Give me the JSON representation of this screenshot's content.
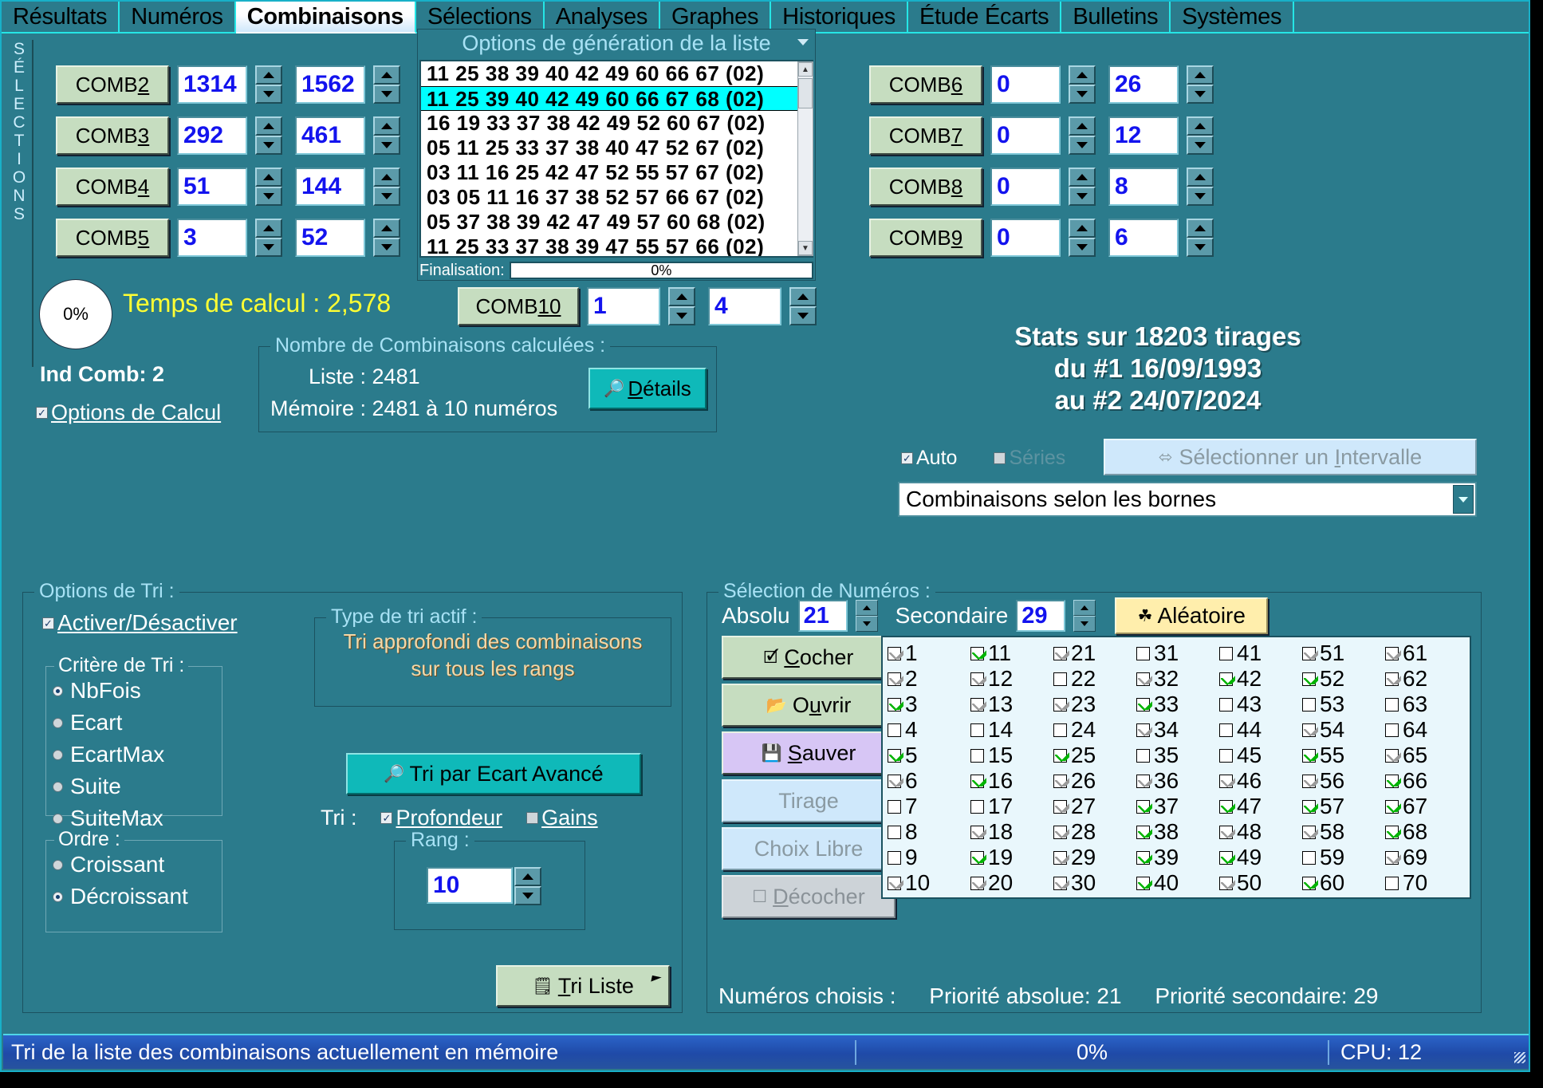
{
  "tabs": [
    {
      "label": "Résultats",
      "active": false
    },
    {
      "label": "Numéros",
      "active": false
    },
    {
      "label": "Combinaisons",
      "active": true
    },
    {
      "label": "Sélections",
      "active": false
    },
    {
      "label": "Analyses",
      "active": false
    },
    {
      "label": "Graphes",
      "active": false
    },
    {
      "label": "Historiques",
      "active": false
    },
    {
      "label": "Étude Écarts",
      "active": false
    },
    {
      "label": "Bulletins",
      "active": false
    },
    {
      "label": "Systèmes",
      "active": false
    }
  ],
  "vertical_strip": "SÉLECTIONS",
  "comb_left": [
    {
      "label_prefix": "COMB ",
      "label_key": "2",
      "min": "1314",
      "max": "1562"
    },
    {
      "label_prefix": "COMB ",
      "label_key": "3",
      "min": "292",
      "max": "461"
    },
    {
      "label_prefix": "COMB ",
      "label_key": "4",
      "min": "51",
      "max": "144"
    },
    {
      "label_prefix": "COMB ",
      "label_key": "5",
      "min": "3",
      "max": "52"
    }
  ],
  "comb_right": [
    {
      "label_prefix": "COMB ",
      "label_key": "6",
      "min": "0",
      "max": "26"
    },
    {
      "label_prefix": "COMB ",
      "label_key": "7",
      "min": "0",
      "max": "12"
    },
    {
      "label_prefix": "COMB ",
      "label_key": "8",
      "min": "0",
      "max": "8"
    },
    {
      "label_prefix": "COMB ",
      "label_key": "9",
      "min": "0",
      "max": "6"
    }
  ],
  "comb10": {
    "label_prefix": "COMB ",
    "label_key": "10",
    "min": "1",
    "max": "4"
  },
  "list_panel": {
    "title": "Options de génération de la liste",
    "rows": [
      {
        "numbers": "11 25 38 39 40 42 49 60 66 67",
        "tag": "(02)",
        "selected": false
      },
      {
        "numbers": "11 25 39 40 42 49 60 66 67 68",
        "tag": "(02)",
        "selected": true
      },
      {
        "numbers": "16 19 33 37 38 42 49 52 60 67",
        "tag": "(02)",
        "selected": false
      },
      {
        "numbers": "05 11 25 33 37 38 40 47 52 67",
        "tag": "(02)",
        "selected": false
      },
      {
        "numbers": "03 11 16 25 42 47 52 55 57 67",
        "tag": "(02)",
        "selected": false
      },
      {
        "numbers": "03 05 11 16 37 38 52 57 66 67",
        "tag": "(02)",
        "selected": false
      },
      {
        "numbers": "05 37 38 39 42 47 49 57 60 68",
        "tag": "(02)",
        "selected": false
      },
      {
        "numbers": "11 25 33 37 38 39 47 55 57 66",
        "tag": "(02)",
        "selected": false
      }
    ],
    "finalisation_label": "Finalisation:",
    "finalisation_value": "0%"
  },
  "progress_pie": "0%",
  "temps_de_calcul": "Temps de calcul : 2,578",
  "ind_comb": "Ind Comb: 2",
  "options_de_calcul": "Options de Calcul",
  "nombre_combinaisons": {
    "title": "Nombre de Combinaisons calculées :",
    "liste": "Liste :  2481",
    "memoire": "Mémoire :  2481 à 10 numéros",
    "details_button": "Détails"
  },
  "stats": {
    "line1": "Stats sur 18203 tirages",
    "line2": "du #1 16/09/1993",
    "line3": "au #2 24/07/2024"
  },
  "auto_label": "Auto",
  "series_label": "Séries",
  "interval_button": "Sélectionner un Intervalle",
  "combo_value": "Combinaisons selon les bornes",
  "options_tri": {
    "title": "Options de Tri :",
    "activer": "Activer/Désactiver",
    "critere_title": "Critère de Tri :",
    "criteres": [
      {
        "label": "NbFois",
        "selected": true
      },
      {
        "label": "Ecart",
        "selected": false
      },
      {
        "label": "EcartMax",
        "selected": false
      },
      {
        "label": "Suite",
        "selected": false
      },
      {
        "label": "SuiteMax",
        "selected": false
      }
    ],
    "ordre_title": "Ordre :",
    "ordres": [
      {
        "label": "Croissant",
        "selected": false
      },
      {
        "label": "Décroissant",
        "selected": true
      }
    ],
    "type_title": "Type de tri actif :",
    "type_text_line1": "Tri approfondi des combinaisons",
    "type_text_line2": "sur tous les rangs",
    "tri_avance_button": "Tri par Ecart Avancé",
    "tri_label": "Tri :",
    "profondeur": "Profondeur",
    "gains": "Gains",
    "rang_title": "Rang :",
    "rang_value": "10",
    "tri_liste_button": "Tri Liste"
  },
  "selection_numeros": {
    "title": "Sélection de Numéros :",
    "buttons": [
      {
        "label": "Cocher",
        "icon": "checklist-icon",
        "style": "green",
        "enabled": true
      },
      {
        "label": "Ouvrir",
        "icon": "folder-open-icon",
        "style": "green",
        "enabled": true
      },
      {
        "label": "Sauver",
        "icon": "floppy-icon",
        "style": "purple",
        "enabled": true
      },
      {
        "label": "Tirage",
        "icon": "none",
        "style": "disabled",
        "enabled": false
      },
      {
        "label": "Choix Libre",
        "icon": "none",
        "style": "disabled",
        "enabled": false
      },
      {
        "label": "Décocher",
        "icon": "uncheck-icon",
        "style": "gray",
        "enabled": false
      }
    ],
    "absolu_label": "Absolu",
    "absolu_value": "21",
    "secondaire_label": "Secondaire",
    "secondaire_value": "29",
    "aleatoire_label": "Aléatoire",
    "numbers": [
      {
        "n": "1",
        "state": "gray"
      },
      {
        "n": "2",
        "state": "gray"
      },
      {
        "n": "3",
        "state": "green"
      },
      {
        "n": "4",
        "state": "off"
      },
      {
        "n": "5",
        "state": "green"
      },
      {
        "n": "6",
        "state": "gray"
      },
      {
        "n": "7",
        "state": "off"
      },
      {
        "n": "8",
        "state": "off"
      },
      {
        "n": "9",
        "state": "off"
      },
      {
        "n": "10",
        "state": "gray"
      },
      {
        "n": "11",
        "state": "green"
      },
      {
        "n": "12",
        "state": "gray"
      },
      {
        "n": "13",
        "state": "gray"
      },
      {
        "n": "14",
        "state": "off"
      },
      {
        "n": "15",
        "state": "off"
      },
      {
        "n": "16",
        "state": "green"
      },
      {
        "n": "17",
        "state": "off"
      },
      {
        "n": "18",
        "state": "gray"
      },
      {
        "n": "19",
        "state": "green"
      },
      {
        "n": "20",
        "state": "gray"
      },
      {
        "n": "21",
        "state": "gray"
      },
      {
        "n": "22",
        "state": "off"
      },
      {
        "n": "23",
        "state": "gray"
      },
      {
        "n": "24",
        "state": "off"
      },
      {
        "n": "25",
        "state": "green"
      },
      {
        "n": "26",
        "state": "gray"
      },
      {
        "n": "27",
        "state": "gray"
      },
      {
        "n": "28",
        "state": "gray"
      },
      {
        "n": "29",
        "state": "gray"
      },
      {
        "n": "30",
        "state": "gray"
      },
      {
        "n": "31",
        "state": "off"
      },
      {
        "n": "32",
        "state": "gray"
      },
      {
        "n": "33",
        "state": "green"
      },
      {
        "n": "34",
        "state": "gray"
      },
      {
        "n": "35",
        "state": "off"
      },
      {
        "n": "36",
        "state": "gray"
      },
      {
        "n": "37",
        "state": "green"
      },
      {
        "n": "38",
        "state": "green"
      },
      {
        "n": "39",
        "state": "green"
      },
      {
        "n": "40",
        "state": "green"
      },
      {
        "n": "41",
        "state": "off"
      },
      {
        "n": "42",
        "state": "green"
      },
      {
        "n": "43",
        "state": "off"
      },
      {
        "n": "44",
        "state": "off"
      },
      {
        "n": "45",
        "state": "off"
      },
      {
        "n": "46",
        "state": "gray"
      },
      {
        "n": "47",
        "state": "green"
      },
      {
        "n": "48",
        "state": "gray"
      },
      {
        "n": "49",
        "state": "green"
      },
      {
        "n": "50",
        "state": "gray"
      },
      {
        "n": "51",
        "state": "gray"
      },
      {
        "n": "52",
        "state": "green"
      },
      {
        "n": "53",
        "state": "off"
      },
      {
        "n": "54",
        "state": "gray"
      },
      {
        "n": "55",
        "state": "green"
      },
      {
        "n": "56",
        "state": "gray"
      },
      {
        "n": "57",
        "state": "green"
      },
      {
        "n": "58",
        "state": "gray"
      },
      {
        "n": "59",
        "state": "off"
      },
      {
        "n": "60",
        "state": "green"
      },
      {
        "n": "61",
        "state": "gray"
      },
      {
        "n": "62",
        "state": "gray"
      },
      {
        "n": "63",
        "state": "off"
      },
      {
        "n": "64",
        "state": "off"
      },
      {
        "n": "65",
        "state": "gray"
      },
      {
        "n": "66",
        "state": "green"
      },
      {
        "n": "67",
        "state": "green"
      },
      {
        "n": "68",
        "state": "green"
      },
      {
        "n": "69",
        "state": "gray"
      },
      {
        "n": "70",
        "state": "off"
      }
    ],
    "footer_label": "Numéros choisis :",
    "footer_abs": "Priorité absolue: 21",
    "footer_sec": "Priorité secondaire: 29"
  },
  "statusbar": {
    "message": "Tri de la liste des combinaisons actuellement en mémoire",
    "progress": "0%",
    "cpu": "CPU: 12"
  },
  "colors": {
    "window_bg": "#2b7b8c",
    "accent_cyan": "#00ffff",
    "button_green": "#c6ddc0",
    "button_teal": "#0fb9b9",
    "value_blue": "#1313ee",
    "status_blue": "#1f4aa8"
  }
}
